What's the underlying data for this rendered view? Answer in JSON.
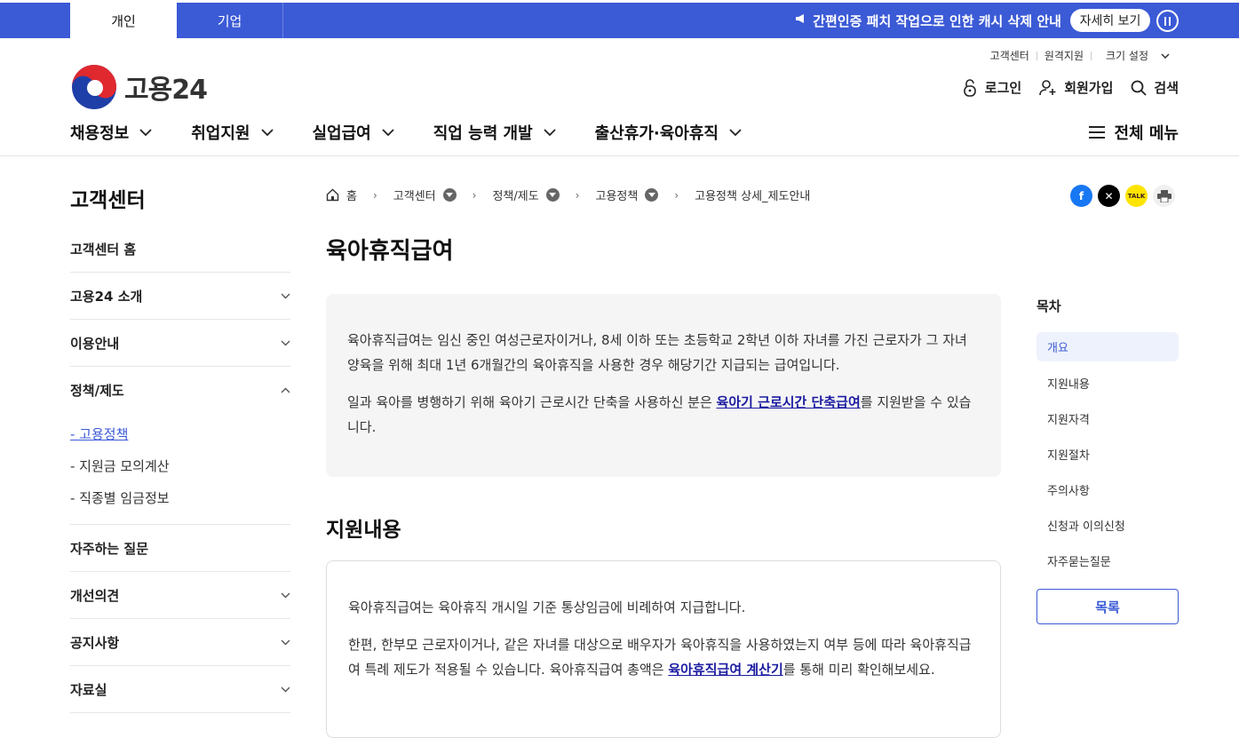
{
  "topbar": {
    "tabs": [
      {
        "label": "개인"
      },
      {
        "label": "기업"
      }
    ],
    "notice": "간편인증 패치 작업으로 인한 캐시 삭제 안내",
    "more_label": "자세히 보기"
  },
  "header": {
    "logo_text": "고용24",
    "util_links": [
      "고객센터",
      "원격지원",
      "크기 설정"
    ],
    "login": "로그인",
    "signup": "회원가입",
    "search": "검색",
    "gnb": [
      "채용정보",
      "취업지원",
      "실업급여",
      "직업 능력 개발",
      "출산휴가·육아휴직"
    ],
    "all_menu": "전체 메뉴"
  },
  "sidebar": {
    "title": "고객센터",
    "items": [
      {
        "label": "고객센터 홈"
      },
      {
        "label": "고용24 소개"
      },
      {
        "label": "이용안내"
      },
      {
        "label": "정책/제도"
      },
      {
        "label": "자주하는 질문"
      },
      {
        "label": "개선의견"
      },
      {
        "label": "공지사항"
      },
      {
        "label": "자료실"
      }
    ],
    "sub_items": [
      {
        "label": "- 고용정책"
      },
      {
        "label": "- 지원금 모의계산"
      },
      {
        "label": "- 직종별 임금정보"
      }
    ]
  },
  "breadcrumb": [
    "홈",
    "고객센터",
    "정책/제도",
    "고용정책",
    "고용정책 상세_제도안내"
  ],
  "main": {
    "title": "육아휴직급여",
    "intro_p1": "육아휴직급여는 임신 중인 여성근로자이거나, 8세 이하 또는 초등학교 2학년 이하 자녀를 가진 근로자가 그 자녀 양육을 위해 최대 1년 6개월간의 육아휴직을 사용한 경우 해당기간 지급되는 급여입니다.",
    "intro_p2_before": "일과 육아를 병행하기 위해 육아기 근로시간 단축을 사용하신 분은 ",
    "intro_p2_link": "육아기 근로시간 단축급여",
    "intro_p2_after": "를 지원받을 수 있습니다.",
    "section_title": "지원내용",
    "content_p1": "육아휴직급여는 육아휴직 개시일 기준 통상임금에 비례하여 지급합니다.",
    "content_p2_before": "한편, 한부모 근로자이거나, 같은 자녀를 대상으로 배우자가 육아휴직을 사용하였는지 여부 등에 따라 육아휴직급여 특례 제도가 적용될 수 있습니다. 육아휴직급여 총액은 ",
    "content_p2_link": "육아휴직급여 계산기",
    "content_p2_after": "를 통해 미리 확인해보세요."
  },
  "toc": {
    "title": "목차",
    "items": [
      "개요",
      "지원내용",
      "지원자격",
      "지원절차",
      "주의사항",
      "신청과 이의신청",
      "자주묻는질문"
    ],
    "list_button": "목록"
  },
  "colors": {
    "brand": "#3b5ad6",
    "link": "#1a1aa0"
  }
}
